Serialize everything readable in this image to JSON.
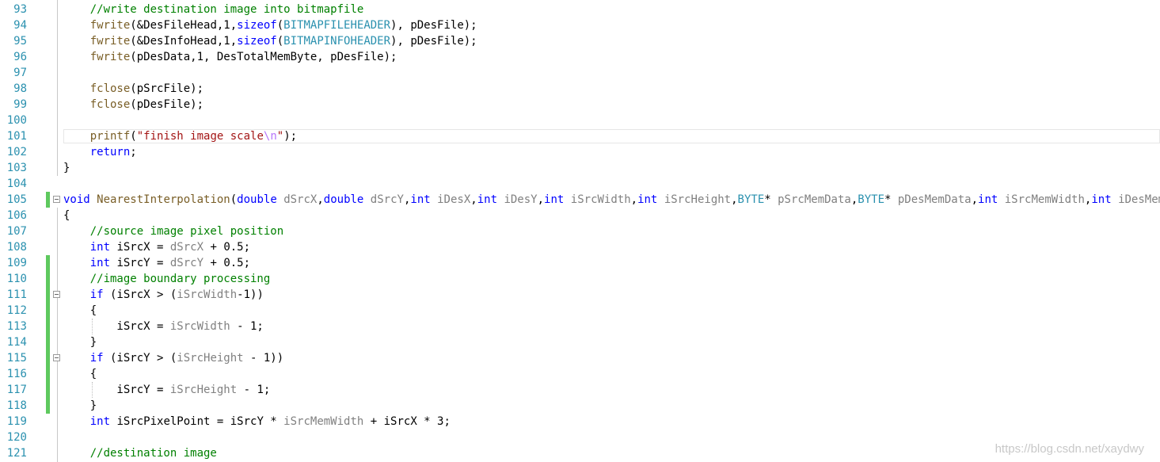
{
  "colors": {
    "line_number": "#2b91af",
    "keyword": "#0000ff",
    "comment": "#008000",
    "string": "#a31515",
    "function": "#795e26",
    "type": "#2b91af",
    "param": "#808080",
    "change_bar": "#5ec95e"
  },
  "watermark": "https://blog.csdn.net/xaydwy",
  "lines": [
    {
      "num": "93",
      "tokens": [
        {
          "t": "    "
        },
        {
          "t": "//write destination image into bitmapfile",
          "c": "cm"
        }
      ]
    },
    {
      "num": "94",
      "tokens": [
        {
          "t": "    "
        },
        {
          "t": "fwrite",
          "c": "fn"
        },
        {
          "t": "(&DesFileHead,1,"
        },
        {
          "t": "sizeof",
          "c": "kw"
        },
        {
          "t": "("
        },
        {
          "t": "BITMAPFILEHEADER",
          "c": "ty"
        },
        {
          "t": "), pDesFile);"
        }
      ]
    },
    {
      "num": "95",
      "tokens": [
        {
          "t": "    "
        },
        {
          "t": "fwrite",
          "c": "fn"
        },
        {
          "t": "(&DesInfoHead,1,"
        },
        {
          "t": "sizeof",
          "c": "kw"
        },
        {
          "t": "("
        },
        {
          "t": "BITMAPINFOHEADER",
          "c": "ty"
        },
        {
          "t": "), pDesFile);"
        }
      ]
    },
    {
      "num": "96",
      "tokens": [
        {
          "t": "    "
        },
        {
          "t": "fwrite",
          "c": "fn"
        },
        {
          "t": "(pDesData,1, DesTotalMemByte, pDesFile);"
        }
      ]
    },
    {
      "num": "97",
      "tokens": []
    },
    {
      "num": "98",
      "tokens": [
        {
          "t": "    "
        },
        {
          "t": "fclose",
          "c": "fn"
        },
        {
          "t": "(pSrcFile);"
        }
      ]
    },
    {
      "num": "99",
      "tokens": [
        {
          "t": "    "
        },
        {
          "t": "fclose",
          "c": "fn"
        },
        {
          "t": "(pDesFile);"
        }
      ]
    },
    {
      "num": "100",
      "tokens": []
    },
    {
      "num": "101",
      "tokens": [
        {
          "t": "    "
        },
        {
          "t": "printf",
          "c": "fn"
        },
        {
          "t": "("
        },
        {
          "t": "\"finish image scale",
          "c": "st"
        },
        {
          "t": "\\n",
          "c": "esc"
        },
        {
          "t": "\"",
          "c": "st"
        },
        {
          "t": ");"
        }
      ]
    },
    {
      "num": "102",
      "tokens": [
        {
          "t": "    "
        },
        {
          "t": "return",
          "c": "kw"
        },
        {
          "t": ";"
        }
      ]
    },
    {
      "num": "103",
      "tokens": [
        {
          "t": "}"
        }
      ]
    },
    {
      "num": "104",
      "tokens": []
    },
    {
      "num": "105",
      "tokens": [
        {
          "t": "void",
          "c": "kw"
        },
        {
          "t": " "
        },
        {
          "t": "NearestInterpolation",
          "c": "fn"
        },
        {
          "t": "("
        },
        {
          "t": "double",
          "c": "kw"
        },
        {
          "t": " "
        },
        {
          "t": "dSrcX",
          "c": "pr"
        },
        {
          "t": ","
        },
        {
          "t": "double",
          "c": "kw"
        },
        {
          "t": " "
        },
        {
          "t": "dSrcY",
          "c": "pr"
        },
        {
          "t": ","
        },
        {
          "t": "int",
          "c": "kw"
        },
        {
          "t": " "
        },
        {
          "t": "iDesX",
          "c": "pr"
        },
        {
          "t": ","
        },
        {
          "t": "int",
          "c": "kw"
        },
        {
          "t": " "
        },
        {
          "t": "iDesY",
          "c": "pr"
        },
        {
          "t": ","
        },
        {
          "t": "int",
          "c": "kw"
        },
        {
          "t": " "
        },
        {
          "t": "iSrcWidth",
          "c": "pr"
        },
        {
          "t": ","
        },
        {
          "t": "int",
          "c": "kw"
        },
        {
          "t": " "
        },
        {
          "t": "iSrcHeight",
          "c": "pr"
        },
        {
          "t": ","
        },
        {
          "t": "BYTE",
          "c": "ty"
        },
        {
          "t": "* "
        },
        {
          "t": "pSrcMemData",
          "c": "pr"
        },
        {
          "t": ","
        },
        {
          "t": "BYTE",
          "c": "ty"
        },
        {
          "t": "* "
        },
        {
          "t": "pDesMemData",
          "c": "pr"
        },
        {
          "t": ","
        },
        {
          "t": "int",
          "c": "kw"
        },
        {
          "t": " "
        },
        {
          "t": "iSrcMemWidth",
          "c": "pr"
        },
        {
          "t": ","
        },
        {
          "t": "int",
          "c": "kw"
        },
        {
          "t": " "
        },
        {
          "t": "iDesMemWidth",
          "c": "pr"
        },
        {
          "t": ")"
        }
      ]
    },
    {
      "num": "106",
      "tokens": [
        {
          "t": "{"
        }
      ]
    },
    {
      "num": "107",
      "tokens": [
        {
          "t": "    "
        },
        {
          "t": "//source image pixel position",
          "c": "cm"
        }
      ]
    },
    {
      "num": "108",
      "tokens": [
        {
          "t": "    "
        },
        {
          "t": "int",
          "c": "kw"
        },
        {
          "t": " iSrcX = "
        },
        {
          "t": "dSrcX",
          "c": "pr"
        },
        {
          "t": " + 0.5;"
        }
      ]
    },
    {
      "num": "109",
      "tokens": [
        {
          "t": "    "
        },
        {
          "t": "int",
          "c": "kw"
        },
        {
          "t": " iSrcY = "
        },
        {
          "t": "dSrcY",
          "c": "pr"
        },
        {
          "t": " + 0.5;"
        }
      ]
    },
    {
      "num": "110",
      "tokens": [
        {
          "t": "    "
        },
        {
          "t": "//image boundary processing",
          "c": "cm"
        }
      ]
    },
    {
      "num": "111",
      "tokens": [
        {
          "t": "    "
        },
        {
          "t": "if",
          "c": "kw"
        },
        {
          "t": " (iSrcX > ("
        },
        {
          "t": "iSrcWidth",
          "c": "pr"
        },
        {
          "t": "-1))"
        }
      ]
    },
    {
      "num": "112",
      "tokens": [
        {
          "t": "    {"
        }
      ]
    },
    {
      "num": "113",
      "tokens": [
        {
          "t": "        iSrcX = "
        },
        {
          "t": "iSrcWidth",
          "c": "pr"
        },
        {
          "t": " - 1;"
        }
      ]
    },
    {
      "num": "114",
      "tokens": [
        {
          "t": "    }"
        }
      ]
    },
    {
      "num": "115",
      "tokens": [
        {
          "t": "    "
        },
        {
          "t": "if",
          "c": "kw"
        },
        {
          "t": " (iSrcY > ("
        },
        {
          "t": "iSrcHeight",
          "c": "pr"
        },
        {
          "t": " - 1))"
        }
      ]
    },
    {
      "num": "116",
      "tokens": [
        {
          "t": "    {"
        }
      ]
    },
    {
      "num": "117",
      "tokens": [
        {
          "t": "        iSrcY = "
        },
        {
          "t": "iSrcHeight",
          "c": "pr"
        },
        {
          "t": " - 1;"
        }
      ]
    },
    {
      "num": "118",
      "tokens": [
        {
          "t": "    }"
        }
      ]
    },
    {
      "num": "119",
      "tokens": [
        {
          "t": "    "
        },
        {
          "t": "int",
          "c": "kw"
        },
        {
          "t": " iSrcPixelPoint = iSrcY * "
        },
        {
          "t": "iSrcMemWidth",
          "c": "pr"
        },
        {
          "t": " + iSrcX * 3;"
        }
      ]
    },
    {
      "num": "120",
      "tokens": []
    },
    {
      "num": "121",
      "tokens": [
        {
          "t": "    "
        },
        {
          "t": "//destination image",
          "c": "cm"
        }
      ]
    }
  ]
}
